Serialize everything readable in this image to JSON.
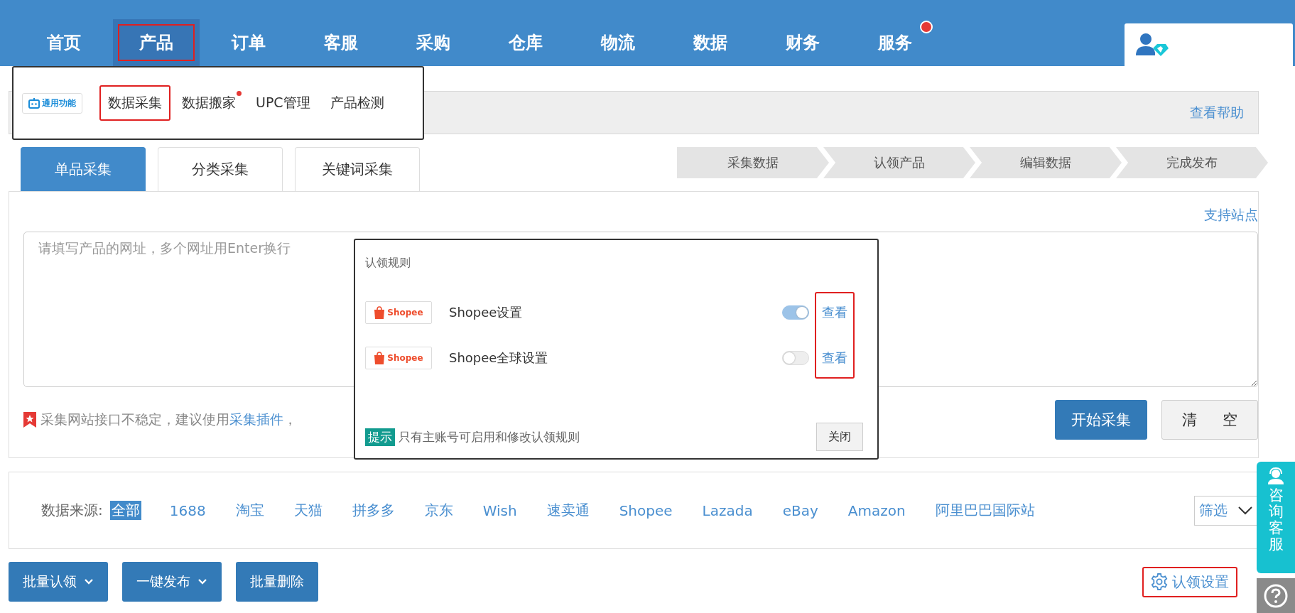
{
  "nav": {
    "items": [
      {
        "label": "首页",
        "selected": false,
        "highlighted": false,
        "dot": false
      },
      {
        "label": "产品",
        "selected": true,
        "highlighted": true,
        "dot": false
      },
      {
        "label": "订单",
        "selected": false,
        "highlighted": false,
        "dot": false
      },
      {
        "label": "客服",
        "selected": false,
        "highlighted": false,
        "dot": false
      },
      {
        "label": "采购",
        "selected": false,
        "highlighted": false,
        "dot": false
      },
      {
        "label": "仓库",
        "selected": false,
        "highlighted": false,
        "dot": false
      },
      {
        "label": "物流",
        "selected": false,
        "highlighted": false,
        "dot": false
      },
      {
        "label": "数据",
        "selected": false,
        "highlighted": false,
        "dot": false
      },
      {
        "label": "财务",
        "selected": false,
        "highlighted": false,
        "dot": false
      },
      {
        "label": "服务",
        "selected": false,
        "highlighted": false,
        "dot": true
      }
    ]
  },
  "submenu": {
    "badge": "通用功能",
    "items": [
      {
        "label": "数据采集",
        "highlighted": true,
        "dot": false
      },
      {
        "label": "数据搬家",
        "highlighted": false,
        "dot": true
      },
      {
        "label": "UPC管理",
        "highlighted": false,
        "dot": false
      },
      {
        "label": "产品检测",
        "highlighted": false,
        "dot": false
      }
    ]
  },
  "help_bar": {
    "link": "查看帮助"
  },
  "tabs": [
    {
      "label": "单品采集",
      "selected": true
    },
    {
      "label": "分类采集",
      "selected": false
    },
    {
      "label": "关键词采集",
      "selected": false
    }
  ],
  "steps": [
    "采集数据",
    "认领产品",
    "编辑数据",
    "完成发布"
  ],
  "collect_panel": {
    "support_link": "支持站点",
    "url_field": {
      "placeholder": "请填写产品的网址，多个网址用Enter换行"
    },
    "notice": {
      "text": "采集网站接口不稳定，建议使用",
      "link": "采集插件",
      "tail": "，"
    },
    "buttons": [
      {
        "label": "开始采集",
        "kind": "primary"
      },
      {
        "label": "清 空",
        "kind": "default"
      }
    ]
  },
  "claim_rules_popup": {
    "title": "认领规则",
    "links_highlighted": true,
    "rules": [
      {
        "logo": "Shopee",
        "name": "Shopee设置",
        "on": true,
        "link": "查看"
      },
      {
        "logo": "Shopee",
        "name": "Shopee全球设置",
        "on": false,
        "link": "查看"
      }
    ],
    "tip": {
      "tag": "提示",
      "text": "只有主账号可启用和修改认领规则"
    },
    "close": "关闭"
  },
  "sources": {
    "label": "数据来源:",
    "items": [
      {
        "label": "全部",
        "selected": true
      },
      {
        "label": "1688",
        "selected": false
      },
      {
        "label": "淘宝",
        "selected": false
      },
      {
        "label": "天猫",
        "selected": false
      },
      {
        "label": "拼多多",
        "selected": false
      },
      {
        "label": "京东",
        "selected": false
      },
      {
        "label": "Wish",
        "selected": false
      },
      {
        "label": "速卖通",
        "selected": false
      },
      {
        "label": "Shopee",
        "selected": false
      },
      {
        "label": "Lazada",
        "selected": false
      },
      {
        "label": "eBay",
        "selected": false
      },
      {
        "label": "Amazon",
        "selected": false
      },
      {
        "label": "阿里巴巴国际站",
        "selected": false
      }
    ],
    "filter": "筛选"
  },
  "actions": [
    {
      "label": "批量认领",
      "dropdown": true
    },
    {
      "label": "一键发布",
      "dropdown": true
    },
    {
      "label": "批量删除",
      "dropdown": false
    }
  ],
  "claim_settings": {
    "label": "认领设置",
    "highlighted": true
  },
  "float": {
    "service": "咨询客服"
  }
}
